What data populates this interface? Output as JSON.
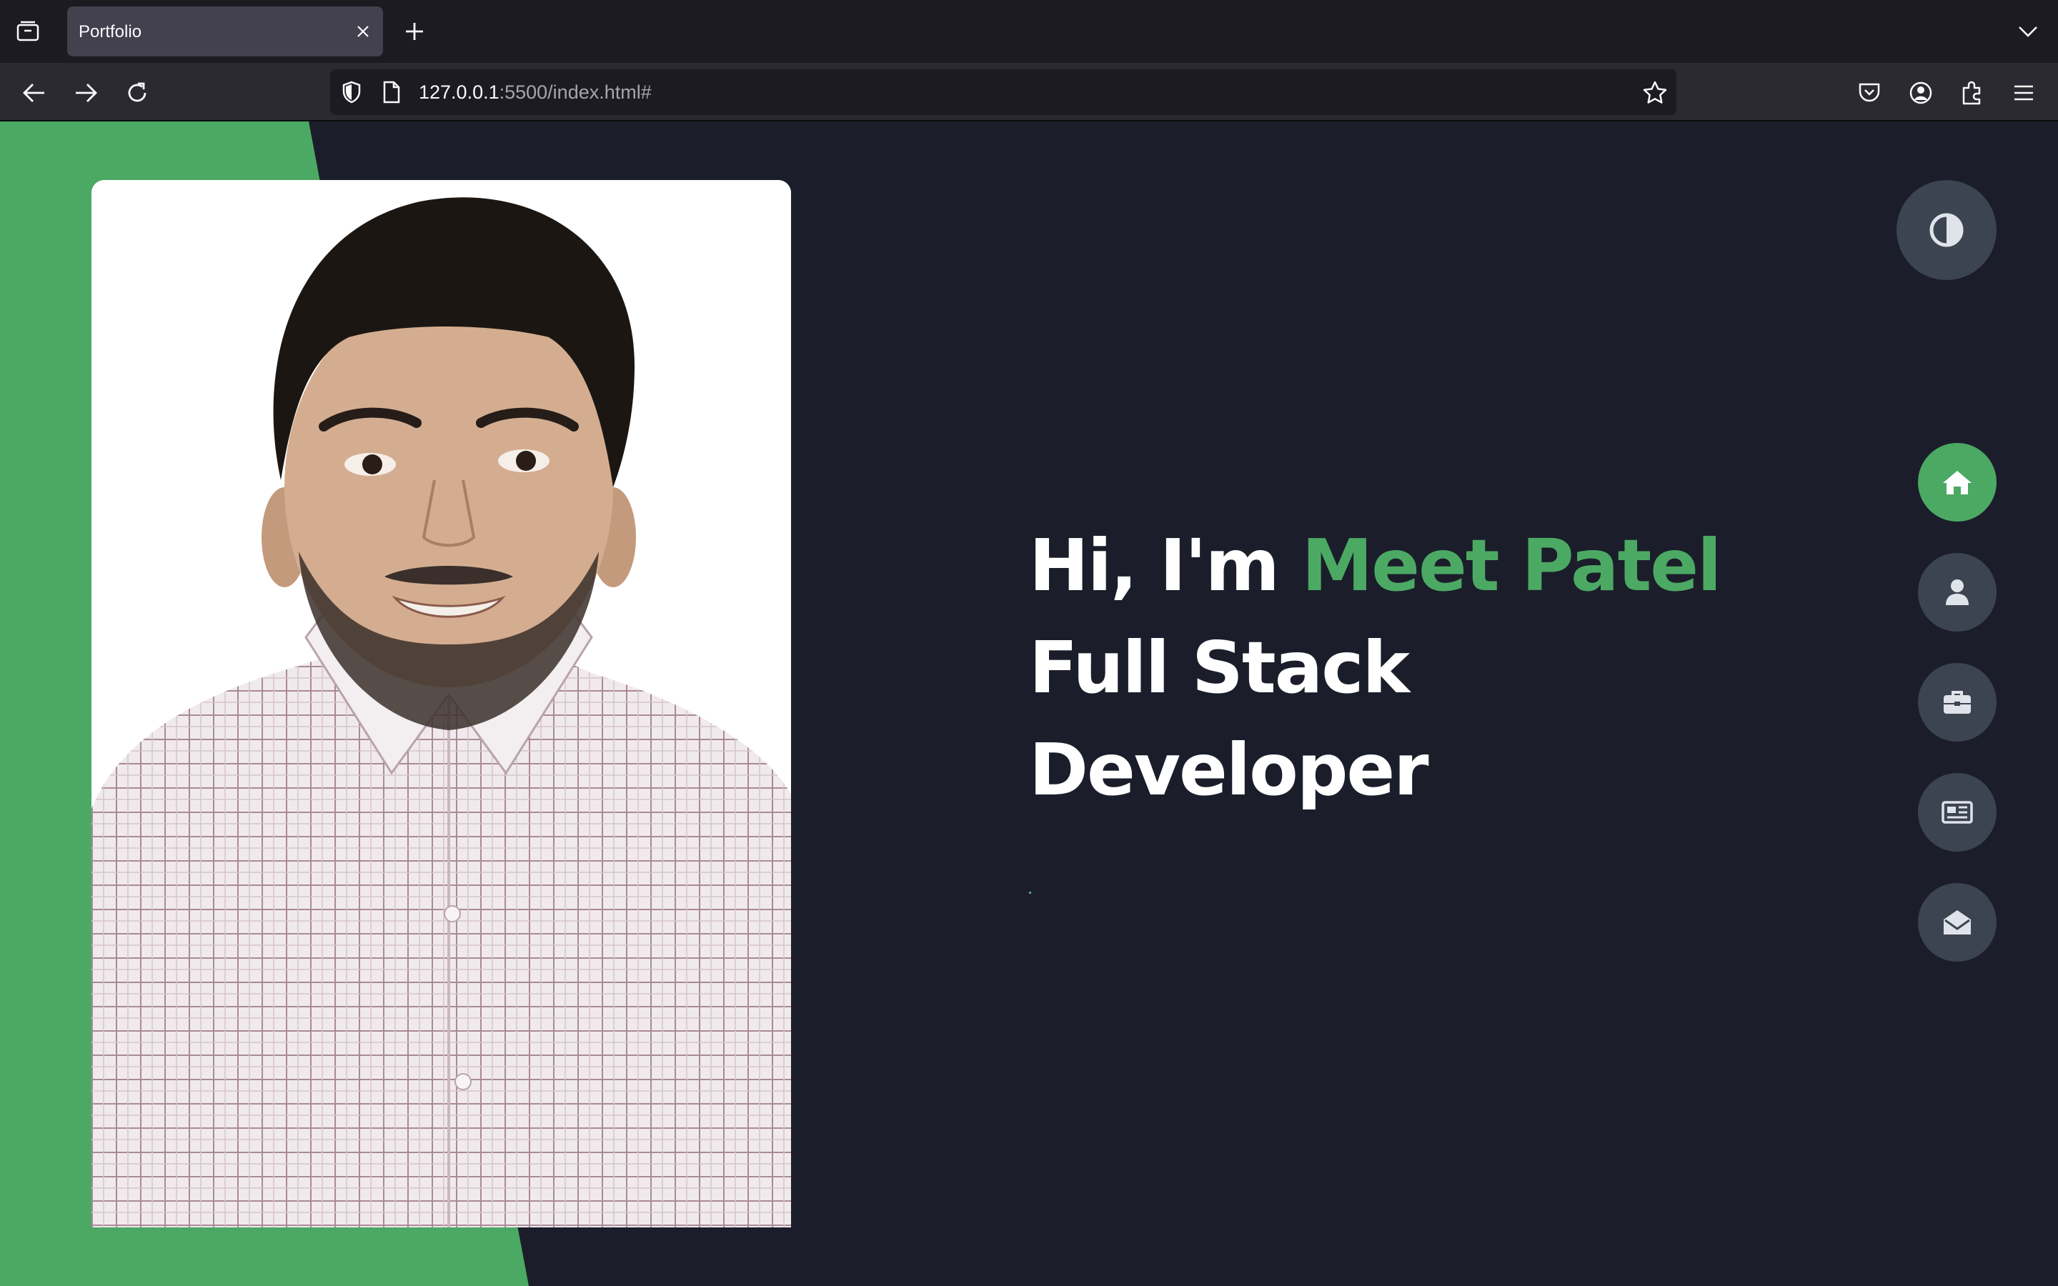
{
  "browser": {
    "tab": {
      "title": "Portfolio"
    },
    "url": {
      "host": "127.0.0.1",
      "rest": ":5500/index.html#"
    },
    "icons": {
      "tab_list": "tab-list-icon",
      "close": "close-icon",
      "new_tab": "plus-icon",
      "overflow": "chevron-down-icon",
      "back": "arrow-left-icon",
      "forward": "arrow-right-icon",
      "reload": "reload-icon",
      "shield": "shield-icon",
      "page": "page-icon",
      "bookmark": "star-icon",
      "pocket": "pocket-icon",
      "account": "account-icon",
      "extensions": "puzzle-icon",
      "menu": "hamburger-icon"
    }
  },
  "page": {
    "hero": {
      "greeting": "Hi, I'm ",
      "name": "Meet Patel",
      "line2": "Full Stack",
      "line3": "Developer"
    },
    "photo_alt": "Portrait of Meet Patel",
    "nav": [
      {
        "id": "home",
        "icon": "home-icon",
        "active": true
      },
      {
        "id": "about",
        "icon": "user-icon",
        "active": false
      },
      {
        "id": "portfolio",
        "icon": "briefcase-icon",
        "active": false
      },
      {
        "id": "blog",
        "icon": "newspaper-icon",
        "active": false
      },
      {
        "id": "contact",
        "icon": "envelope-open-icon",
        "active": false
      }
    ],
    "theme_toggle_icon": "contrast-icon"
  },
  "colors": {
    "accent": "#4ca964",
    "page_bg": "#1b1e2a",
    "button_bg": "#3d4451",
    "text": "#ffffff"
  }
}
